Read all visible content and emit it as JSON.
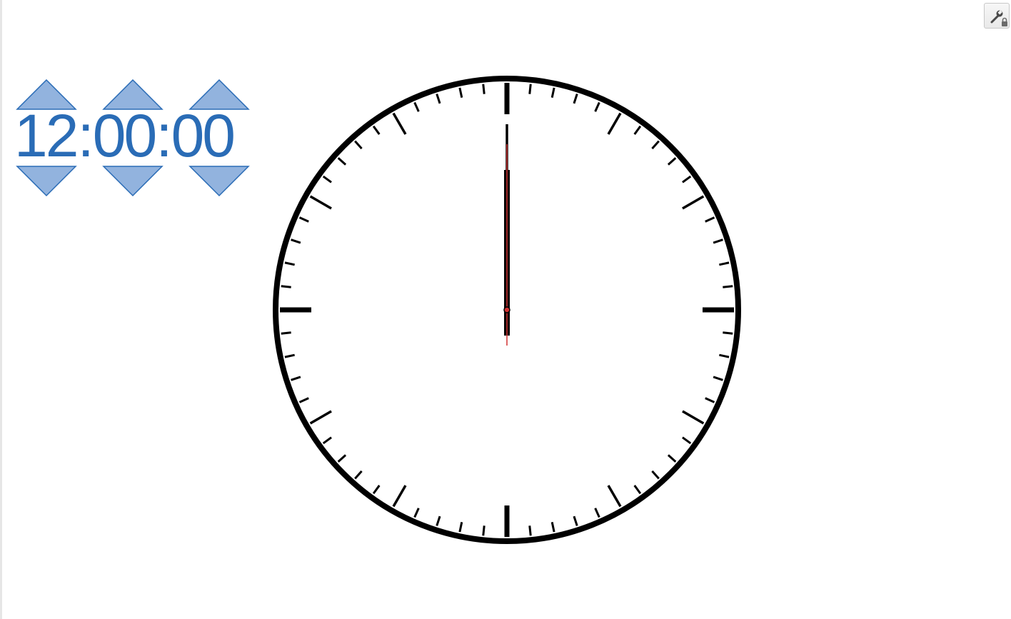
{
  "time": {
    "hours": "12",
    "minutes": "00",
    "seconds": "00",
    "separator": ":"
  },
  "clock": {
    "hour": 12,
    "minute": 0,
    "second": 0,
    "minute_ticks": 60,
    "hand_color": "#000000",
    "second_hand_color": "#d23232"
  },
  "toolbar": {
    "settings_icon": "wrench-lock-icon"
  },
  "colors": {
    "digits": "#2a6cb6",
    "arrow_fill": "#92b3de",
    "arrow_stroke": "#2a6cb6",
    "face_stroke": "#000000"
  },
  "spinners": {
    "up_icon": "triangle-up-icon",
    "down_icon": "triangle-down-icon"
  }
}
